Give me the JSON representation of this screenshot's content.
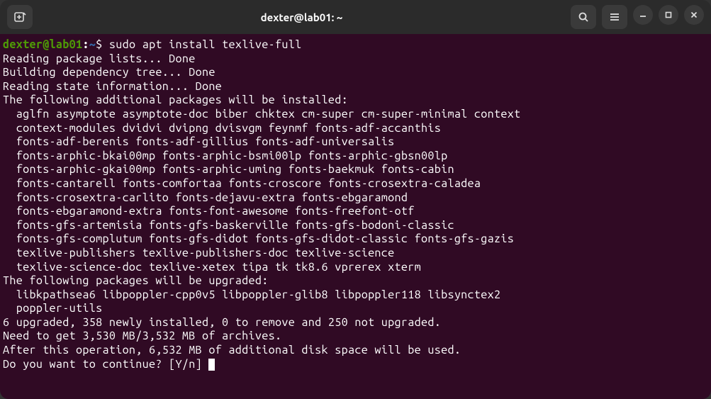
{
  "titlebar": {
    "title": "dexter@lab01: ~"
  },
  "prompt": {
    "user_host": "dexter@lab01",
    "colon": ":",
    "path": "~",
    "symbol": "$"
  },
  "command": "sudo apt install texlive-full",
  "output_lines": [
    "Reading package lists... Done",
    "Building dependency tree... Done",
    "Reading state information... Done",
    "The following additional packages will be installed:",
    "  aglfn asymptote asymptote-doc biber chktex cm-super cm-super-minimal context",
    "  context-modules dvidvi dvipng dvisvgm feynmf fonts-adf-accanthis",
    "  fonts-adf-berenis fonts-adf-gillius fonts-adf-universalis",
    "  fonts-arphic-bkai00mp fonts-arphic-bsmi00lp fonts-arphic-gbsn00lp",
    "  fonts-arphic-gkai00mp fonts-arphic-uming fonts-baekmuk fonts-cabin",
    "  fonts-cantarell fonts-comfortaa fonts-croscore fonts-crosextra-caladea",
    "  fonts-crosextra-carlito fonts-dejavu-extra fonts-ebgaramond",
    "  fonts-ebgaramond-extra fonts-font-awesome fonts-freefont-otf",
    "  fonts-gfs-artemisia fonts-gfs-baskerville fonts-gfs-bodoni-classic",
    "  fonts-gfs-complutum fonts-gfs-didot fonts-gfs-didot-classic fonts-gfs-gazis",
    "  texlive-publishers texlive-publishers-doc texlive-science",
    "  texlive-science-doc texlive-xetex tipa tk tk8.6 vprerex xterm",
    "The following packages will be upgraded:",
    "  libkpathsea6 libpoppler-cpp0v5 libpoppler-glib8 libpoppler118 libsynctex2",
    "  poppler-utils",
    "6 upgraded, 358 newly installed, 0 to remove and 250 not upgraded.",
    "Need to get 3,530 MB/3,532 MB of archives.",
    "After this operation, 6,532 MB of additional disk space will be used.",
    "Do you want to continue? [Y/n] "
  ]
}
